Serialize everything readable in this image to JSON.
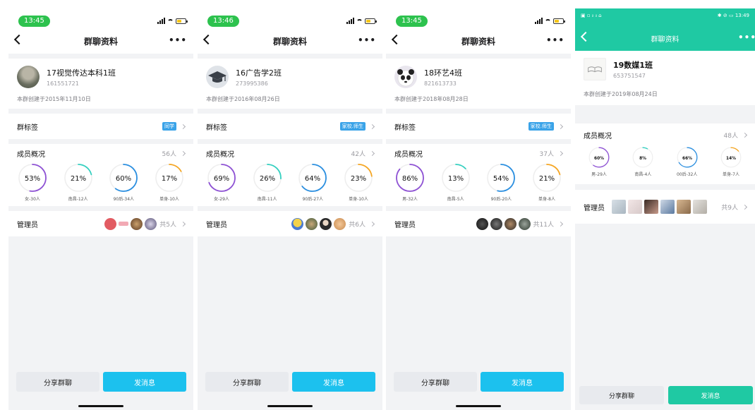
{
  "screens": [
    {
      "time": "13:45",
      "title": "群聊资料",
      "group_name": "17视觉传达本科1班",
      "group_id": "161551721",
      "created": "本群创建于2015年11月10日",
      "tag_row": {
        "label": "群标签",
        "tag": "同学"
      },
      "stats": {
        "label": "成员概况",
        "count": "56人",
        "rings": [
          {
            "pct": "53%",
            "value": 0.53,
            "label": "女-30人",
            "color": "#8e52d4"
          },
          {
            "pct": "21%",
            "value": 0.21,
            "label": "南昌-12人",
            "color": "#35d0c0"
          },
          {
            "pct": "60%",
            "value": 0.6,
            "label": "90后-34人",
            "color": "#2b8fe0"
          },
          {
            "pct": "17%",
            "value": 0.17,
            "label": "单身-10人",
            "color": "#f5a623"
          }
        ]
      },
      "admins": {
        "label": "管理员",
        "count": "共5人"
      },
      "buttons": {
        "share": "分享群聊",
        "send": "发消息"
      }
    },
    {
      "time": "13:46",
      "title": "群聊资料",
      "group_name": "16广告学2班",
      "group_id": "273995386",
      "created": "本群创建于2016年08月26日",
      "tag_row": {
        "label": "群标签",
        "tag": "家校.师生"
      },
      "stats": {
        "label": "成员概况",
        "count": "42人",
        "rings": [
          {
            "pct": "69%",
            "value": 0.69,
            "label": "女-29人",
            "color": "#8e52d4"
          },
          {
            "pct": "26%",
            "value": 0.26,
            "label": "南昌-11人",
            "color": "#35d0c0"
          },
          {
            "pct": "64%",
            "value": 0.64,
            "label": "90后-27人",
            "color": "#2b8fe0"
          },
          {
            "pct": "23%",
            "value": 0.23,
            "label": "单身-10人",
            "color": "#f5a623"
          }
        ]
      },
      "admins": {
        "label": "管理员",
        "count": "共6人"
      },
      "buttons": {
        "share": "分享群聊",
        "send": "发消息"
      }
    },
    {
      "time": "13:45",
      "title": "群聊资料",
      "group_name": "18环艺4班",
      "group_id": "821613733",
      "created": "本群创建于2018年08月28日",
      "tag_row": {
        "label": "群标签",
        "tag": "家校.师生"
      },
      "stats": {
        "label": "成员概况",
        "count": "37人",
        "rings": [
          {
            "pct": "86%",
            "value": 0.86,
            "label": "男-32人",
            "color": "#8e52d4"
          },
          {
            "pct": "13%",
            "value": 0.13,
            "label": "南昌-5人",
            "color": "#35d0c0"
          },
          {
            "pct": "54%",
            "value": 0.54,
            "label": "90后-20人",
            "color": "#2b8fe0"
          },
          {
            "pct": "21%",
            "value": 0.21,
            "label": "单身-8人",
            "color": "#f5a623"
          }
        ]
      },
      "admins": {
        "label": "管理员",
        "count": "共11人"
      },
      "buttons": {
        "share": "分享群聊",
        "send": "发消息"
      }
    },
    {
      "time": "13:49",
      "title": "群聊资料",
      "group_name": "19数媒1班",
      "group_id": "653751547",
      "created": "本群创建于2019年08月24日",
      "stats": {
        "label": "成员概况",
        "count": "48人",
        "rings": [
          {
            "pct": "60%",
            "value": 0.6,
            "label": "男-29人",
            "color": "#8e52d4"
          },
          {
            "pct": "8%",
            "value": 0.08,
            "label": "南昌-4人",
            "color": "#35d0c0"
          },
          {
            "pct": "66%",
            "value": 0.66,
            "label": "00后-32人",
            "color": "#2b8fe0"
          },
          {
            "pct": "14%",
            "value": 0.14,
            "label": "单身-7人",
            "color": "#f5a623"
          }
        ]
      },
      "admins": {
        "label": "管理员",
        "count": "共9人"
      },
      "buttons": {
        "share": "分享群聊",
        "send": "发消息"
      }
    }
  ]
}
